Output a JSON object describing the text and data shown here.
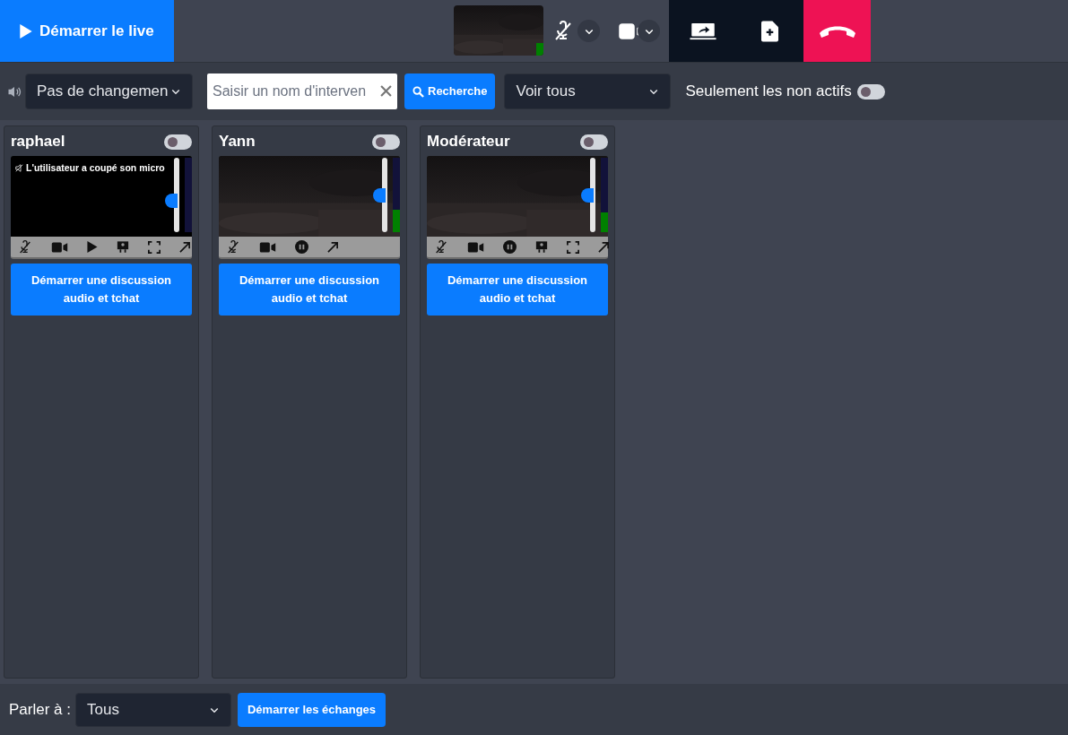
{
  "top_bar": {
    "start_live": "Démarrer le live",
    "mic_muted": true,
    "camera_on": true
  },
  "filter_bar": {
    "audio_select": "Pas de changemen",
    "search": {
      "placeholder": "Saisir un nom d'interven"
    },
    "search_button": "Recherche",
    "view_select": "Voir tous",
    "inactive_toggle": {
      "label": "Seulement les non actifs",
      "on": false
    }
  },
  "participants": [
    {
      "name": "raphael",
      "on": false,
      "notice": "L'utilisateur a coupé son micro",
      "video": {
        "kind": "black"
      },
      "volume": {
        "level": 0.4
      },
      "meter": {
        "level": 0
      },
      "controls": [
        {
          "kind": "mic_off"
        },
        {
          "kind": "camera"
        },
        {
          "kind": "play"
        },
        {
          "kind": "presenter"
        },
        {
          "kind": "fullscreen"
        },
        {
          "kind": "expand"
        }
      ],
      "action": "Démarrer une discussion audio et tchat"
    },
    {
      "name": "Yann",
      "on": false,
      "volume": {
        "level": 0.5
      },
      "meter": {
        "level": 0.3
      },
      "controls": [
        {
          "kind": "mic_off"
        },
        {
          "kind": "camera"
        },
        {
          "kind": "pause"
        },
        {
          "kind": "expand"
        }
      ],
      "action": "Démarrer une discussion audio et tchat"
    },
    {
      "name": "Modérateur",
      "on": false,
      "volume": {
        "level": 0.5
      },
      "meter": {
        "level": 0.27
      },
      "controls": [
        {
          "kind": "mic_off"
        },
        {
          "kind": "camera"
        },
        {
          "kind": "pause"
        },
        {
          "kind": "presenter"
        },
        {
          "kind": "fullscreen"
        },
        {
          "kind": "expand"
        }
      ],
      "action": "Démarrer une discussion audio et tchat"
    }
  ],
  "bottom_bar": {
    "label": "Parler à :",
    "talk_select": "Tous",
    "button": "Démarrer les échanges"
  }
}
